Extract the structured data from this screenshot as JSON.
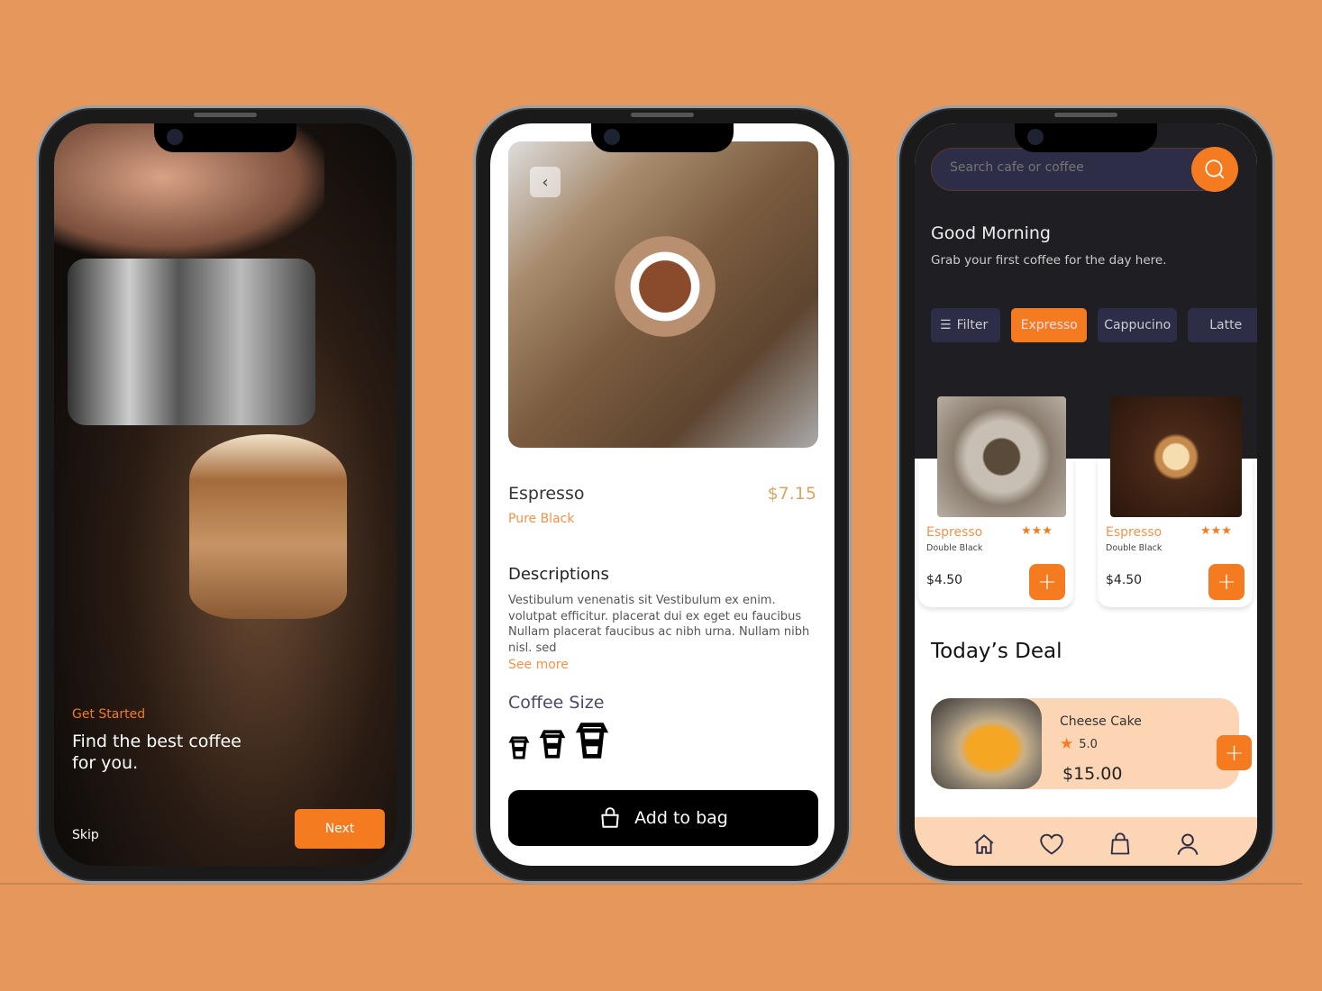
{
  "colors": {
    "background": "#E5975C",
    "accent": "#F47B20",
    "dark": "#1F1E22",
    "chip": "#2E2D48",
    "peach": "#FCD5B5"
  },
  "onboarding": {
    "kicker": "Get Started",
    "headline_1": "Find the best coffee",
    "headline_2": "for you.",
    "skip": "Skip",
    "next": "Next"
  },
  "detail": {
    "back_icon": "chevron-left-icon",
    "name": "Espresso",
    "subtitle": "Pure Black",
    "price": "$7.15",
    "desc_title": "Descriptions",
    "description": "Vestibulum venenatis sit Vestibulum ex enim. volutpat efficitur. placerat dui ex eget eu faucibus Nullam placerat faucibus ac nibh urna. Nullam nibh nisl. sed",
    "see_more": "See more",
    "size_title": "Coffee Size",
    "sizes": [
      "small",
      "medium",
      "large"
    ],
    "add_to_bag": "Add to bag"
  },
  "home": {
    "search_placeholder": "Search cafe or coffee",
    "greeting": "Good Morning",
    "subgreeting": "Grab your first coffee for the day here.",
    "filters": [
      {
        "label": "Filter",
        "active": false
      },
      {
        "label": "Expresso",
        "active": true
      },
      {
        "label": "Cappucino",
        "active": false
      },
      {
        "label": "Latte",
        "active": false
      }
    ],
    "products": [
      {
        "name": "Espresso",
        "sub": "Double Black",
        "price": "$4.50",
        "stars": "★★★"
      },
      {
        "name": "Espresso",
        "sub": "Double Black",
        "price": "$4.50",
        "stars": "★★★"
      }
    ],
    "deal_title": "Today’s Deal",
    "deal": {
      "name": "Cheese Cake",
      "rating": "5.0",
      "price": "$15.00"
    },
    "nav": [
      "home-icon",
      "heart-icon",
      "bag-icon",
      "user-icon"
    ]
  }
}
